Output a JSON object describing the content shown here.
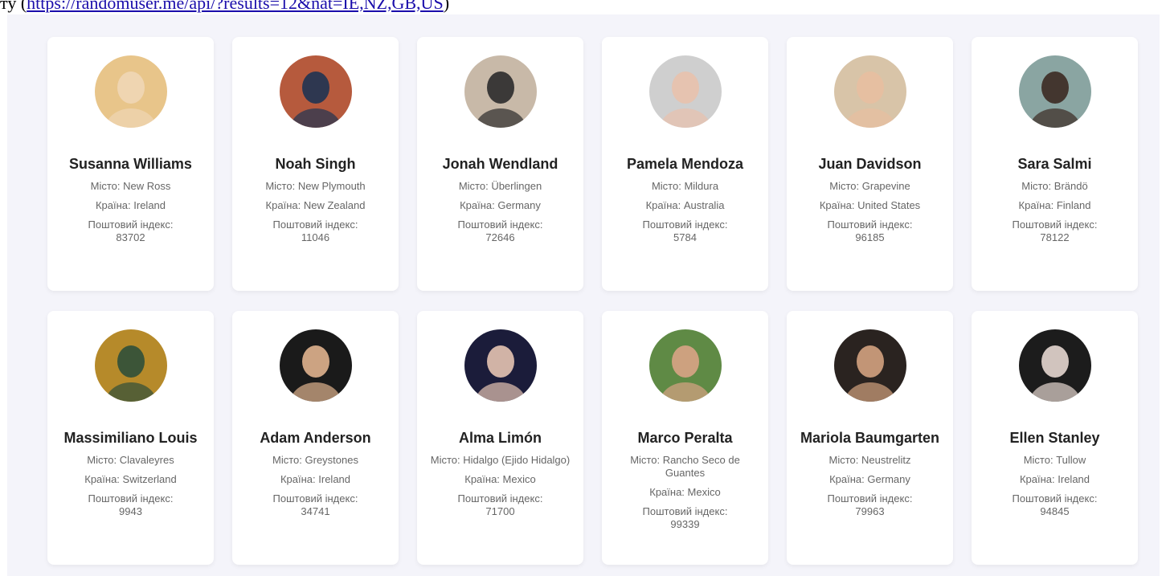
{
  "header": {
    "prefix": "ту",
    "link_text": "https://randomuser.me/api/?results=12&nat=IE,NZ,GB,US",
    "suffix": ")"
  },
  "labels": {
    "city": "Місто:",
    "country": "Країна:",
    "postcode": "Поштовий індекс:"
  },
  "users": [
    {
      "name": "Susanna Williams",
      "city": "New Ross",
      "country": "Ireland",
      "postcode": "83702",
      "bg": "#e8c58a",
      "fg": "#f0d6b5"
    },
    {
      "name": "Noah Singh",
      "city": "New Plymouth",
      "country": "New Zealand",
      "postcode": "11046",
      "bg": "#b65a3d",
      "fg": "#1f3352"
    },
    {
      "name": "Jonah Wendland",
      "city": "Überlingen",
      "country": "Germany",
      "postcode": "72646",
      "bg": "#c8b9a8",
      "fg": "#2b2b2b"
    },
    {
      "name": "Pamela Mendoza",
      "city": "Mildura",
      "country": "Australia",
      "postcode": "5784",
      "bg": "#cfcfcf",
      "fg": "#e8c1ac"
    },
    {
      "name": "Juan Davidson",
      "city": "Grapevine",
      "country": "United States",
      "postcode": "96185",
      "bg": "#d8c4a8",
      "fg": "#e8bfa0"
    },
    {
      "name": "Sara Salmi",
      "city": "Brändö",
      "country": "Finland",
      "postcode": "78122",
      "bg": "#8aa5a2",
      "fg": "#3b2a22"
    },
    {
      "name": "Massimiliano Louis",
      "city": "Clavaleyres",
      "country": "Switzerland",
      "postcode": "9943",
      "bg": "#b68a2a",
      "fg": "#2f4f3a"
    },
    {
      "name": "Adam Anderson",
      "city": "Greystones",
      "country": "Ireland",
      "postcode": "34741",
      "bg": "#1a1a1a",
      "fg": "#e0b38e"
    },
    {
      "name": "Alma Limón",
      "city": "Hidalgo (Ejido Hidalgo)",
      "country": "Mexico",
      "postcode": "71700",
      "bg": "#1b1c3a",
      "fg": "#e5c4b3"
    },
    {
      "name": "Marco Peralta",
      "city": "Rancho Seco de Guantes",
      "country": "Mexico",
      "postcode": "99339",
      "bg": "#5f8a45",
      "fg": "#d9a385"
    },
    {
      "name": "Mariola Baumgarten",
      "city": "Neustrelitz",
      "country": "Germany",
      "postcode": "79963",
      "bg": "#2a2320",
      "fg": "#d3a27f"
    },
    {
      "name": "Ellen Stanley",
      "city": "Tullow",
      "country": "Ireland",
      "postcode": "94845",
      "bg": "#1c1c1c",
      "fg": "#e6d7d0"
    }
  ]
}
